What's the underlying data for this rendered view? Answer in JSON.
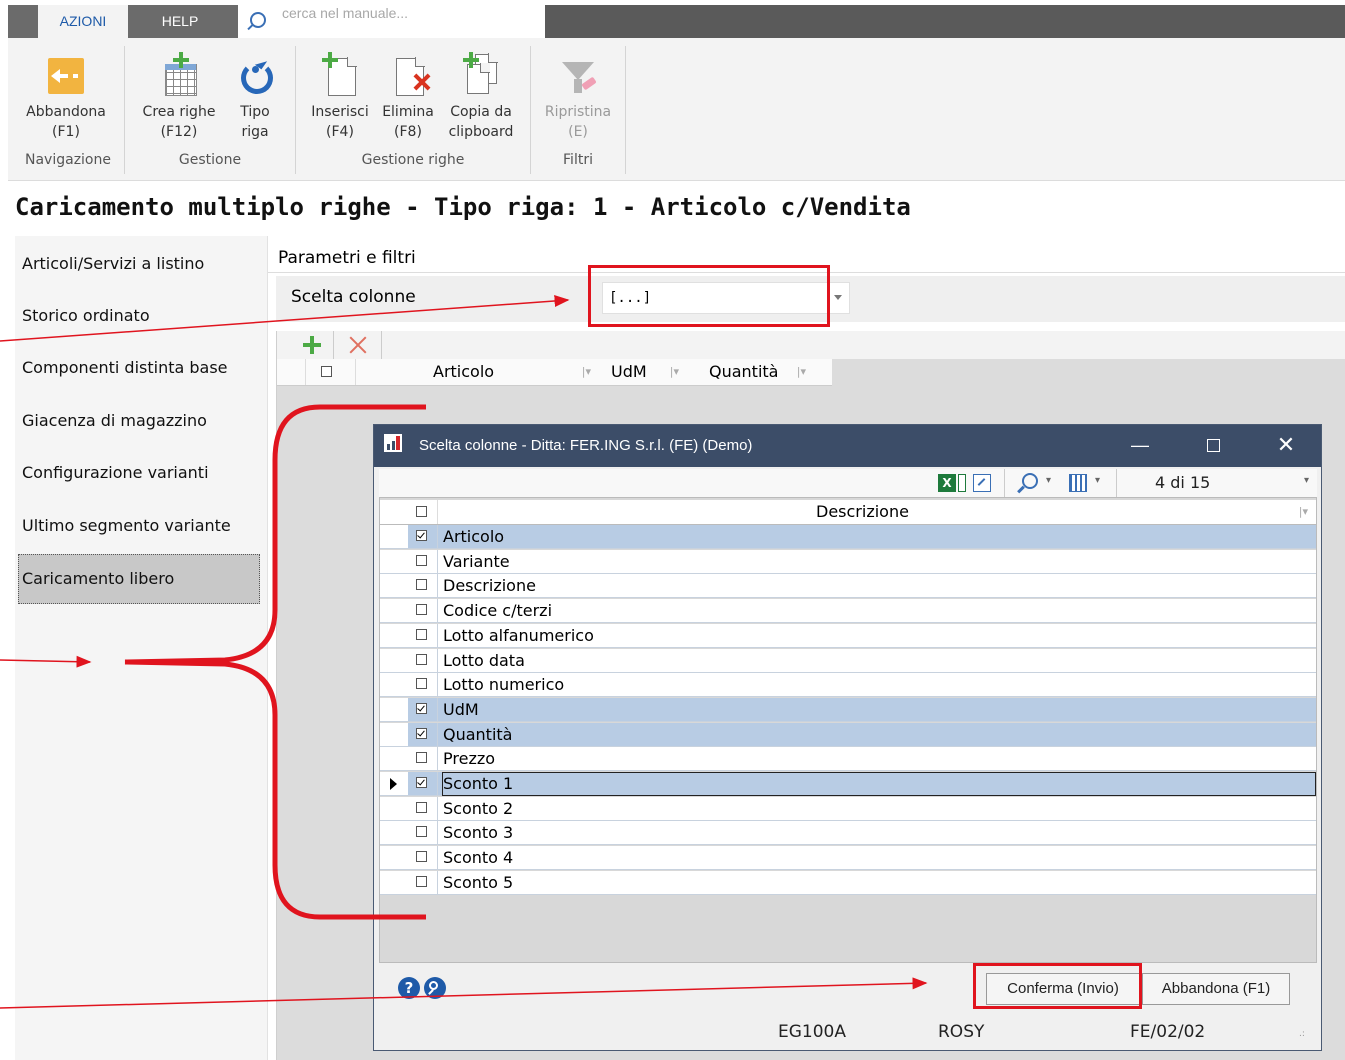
{
  "tabs": {
    "azioni": "AZIONI",
    "help": "HELP"
  },
  "search": {
    "placeholder": "cerca nel manuale..."
  },
  "ribbon": {
    "abbandona": {
      "line1": "Abbandona",
      "line2": "(F1)"
    },
    "crea_righe": {
      "line1": "Crea righe",
      "line2": "(F12)"
    },
    "tipo_riga": {
      "line1": "Tipo",
      "line2": "riga"
    },
    "inserisci": {
      "line1": "Inserisci",
      "line2": "(F4)"
    },
    "elimina": {
      "line1": "Elimina",
      "line2": "(F8)"
    },
    "copia": {
      "line1": "Copia da",
      "line2": "clipboard"
    },
    "ripristina": {
      "line1": "Ripristina",
      "line2": "(E)"
    },
    "groups": {
      "navigazione": "Navigazione",
      "gestione": "Gestione",
      "gestione_righe": "Gestione righe",
      "filtri": "Filtri"
    }
  },
  "page_title": "Caricamento multiplo righe - Tipo riga: 1 - Articolo c/Vendita",
  "sidebar": {
    "items": [
      {
        "label": "Articoli/Servizi a listino"
      },
      {
        "label": "Storico ordinato"
      },
      {
        "label": "Componenti distinta base"
      },
      {
        "label": "Giacenza di magazzino"
      },
      {
        "label": "Configurazione varianti"
      },
      {
        "label": "Ultimo segmento variante"
      },
      {
        "label": "Caricamento libero"
      }
    ]
  },
  "params": {
    "header": "Parametri e filtri",
    "scelta_label": "Scelta colonne",
    "scelta_value": "[...]"
  },
  "grid": {
    "columns": [
      "Articolo",
      "UdM",
      "Quantità"
    ]
  },
  "dialog": {
    "title": "Scelta colonne - Ditta: FER.ING S.r.l. (FE)  (Demo)",
    "counter": "4 di 15",
    "column_header": "Descrizione",
    "rows": [
      {
        "label": "Articolo",
        "checked": true
      },
      {
        "label": "Variante",
        "checked": false
      },
      {
        "label": "Descrizione",
        "checked": false
      },
      {
        "label": "Codice c/terzi",
        "checked": false
      },
      {
        "label": "Lotto alfanumerico",
        "checked": false
      },
      {
        "label": "Lotto data",
        "checked": false
      },
      {
        "label": "Lotto numerico",
        "checked": false
      },
      {
        "label": "UdM",
        "checked": true
      },
      {
        "label": "Quantità",
        "checked": true
      },
      {
        "label": "Prezzo",
        "checked": false
      },
      {
        "label": "Sconto 1",
        "checked": true,
        "current": true
      },
      {
        "label": "Sconto 2",
        "checked": false
      },
      {
        "label": "Sconto 3",
        "checked": false
      },
      {
        "label": "Sconto 4",
        "checked": false
      },
      {
        "label": "Sconto 5",
        "checked": false
      }
    ],
    "confirm_label": "Conferma (Invio)",
    "cancel_label": "Abbandona (F1)",
    "status": {
      "code": "EG100A",
      "user": "ROSY",
      "company": "FE/02/02"
    }
  },
  "colors": {
    "accent": "#1e5aa8",
    "annotation": "#e0141e",
    "selected_row": "#b8cce4",
    "dialog_title": "#3c4d68"
  },
  "icons": [
    "search-icon",
    "back-arrow-icon",
    "create-rows-icon",
    "refresh-icon",
    "insert-icon",
    "delete-icon",
    "copy-icon",
    "filter-clear-icon",
    "excel-icon",
    "export-icon",
    "zoom-icon",
    "columns-icon",
    "help-icon",
    "find-icon"
  ]
}
